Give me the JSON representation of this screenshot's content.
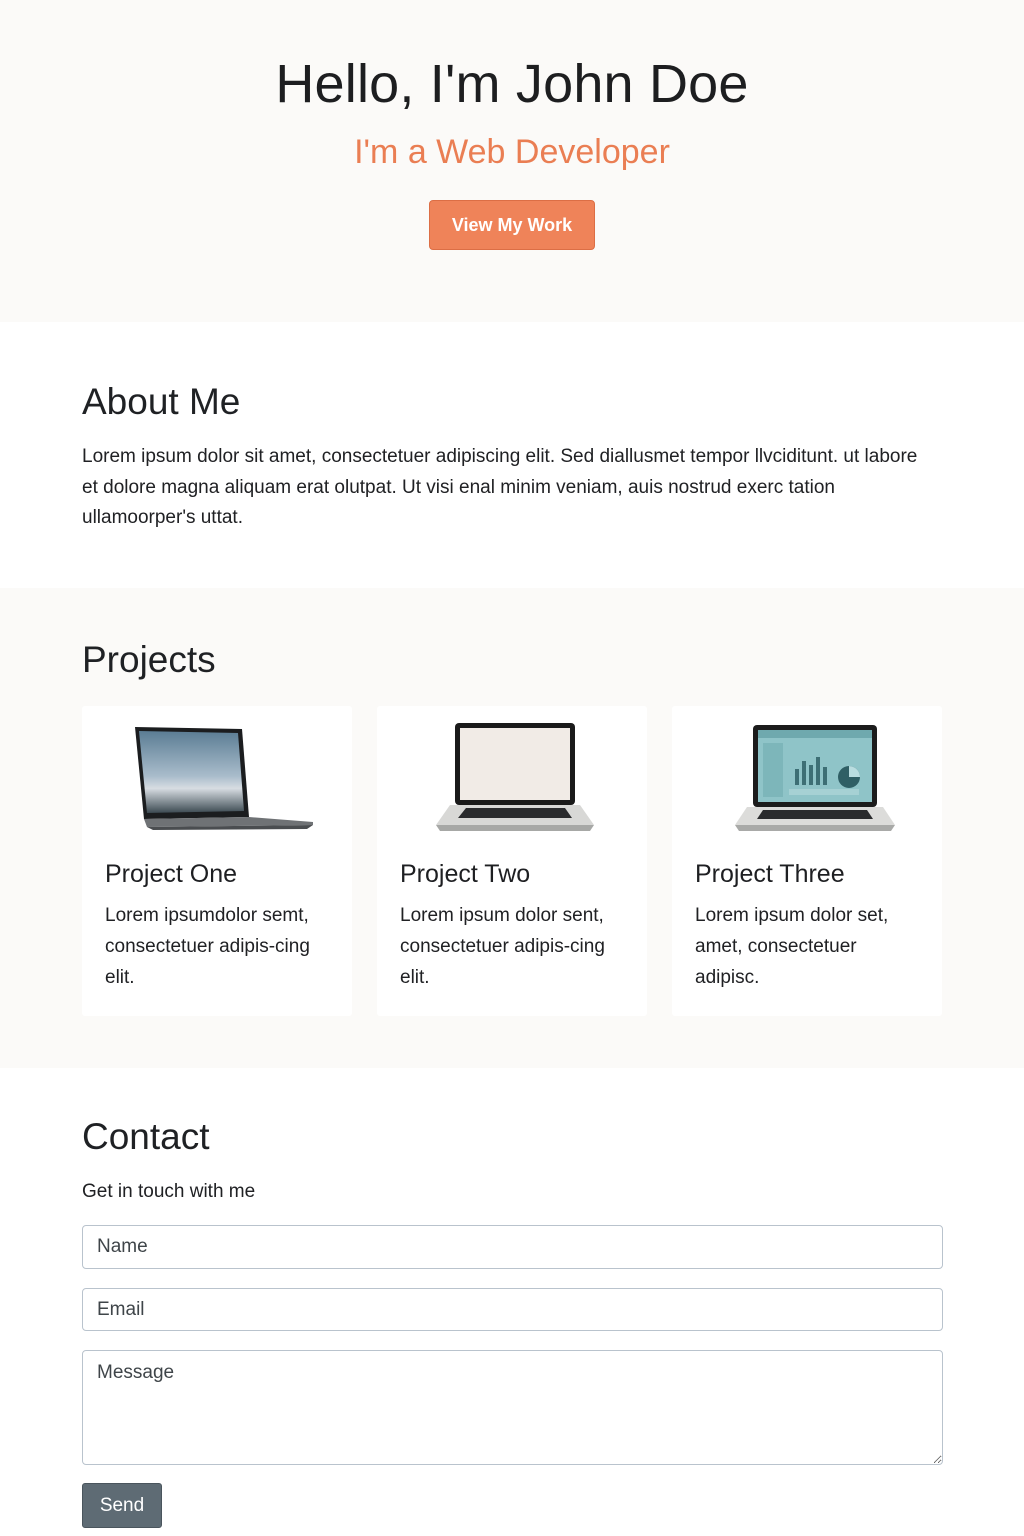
{
  "hero": {
    "title": "Hello, I'm John Doe",
    "subtitle": "I'm a Web Developer",
    "cta_label": "View My Work"
  },
  "about": {
    "heading": "About Me",
    "text": "Lorem ipsum dolor sit amet, consectetuer adipiscing elit. Sed diallusmet tempor llvciditunt. ut labore et dolore magna aliquam erat olutpat. Ut visi enal minim veniam, auis nostrud exerc tation ullamoorper's uttat."
  },
  "projects": {
    "heading": "Projects",
    "items": [
      {
        "title": "Project One",
        "description": "Lorem ipsumdolor semt, consectetuer adipis-cing elit.",
        "image": "laptop-landscape-image"
      },
      {
        "title": "Project Two",
        "description": "Lorem ipsum dolor sent, consectetuer adipis-cing elit.",
        "image": "laptop-blank-screen-image"
      },
      {
        "title": "Project Three",
        "description": "Lorem ipsum dolor set, amet, consectetuer adipisc.",
        "image": "laptop-dashboard-image"
      }
    ]
  },
  "contact": {
    "heading": "Contact",
    "subtitle": "Get in touch with me",
    "name_placeholder": "Name",
    "email_placeholder": "Email",
    "message_placeholder": "Message",
    "send_label": "Send"
  },
  "colors": {
    "accent": "#ef8359",
    "subtitle": "#ea7e53",
    "send_button": "#5e6b74",
    "section_alt_bg": "#fbfaf8"
  }
}
